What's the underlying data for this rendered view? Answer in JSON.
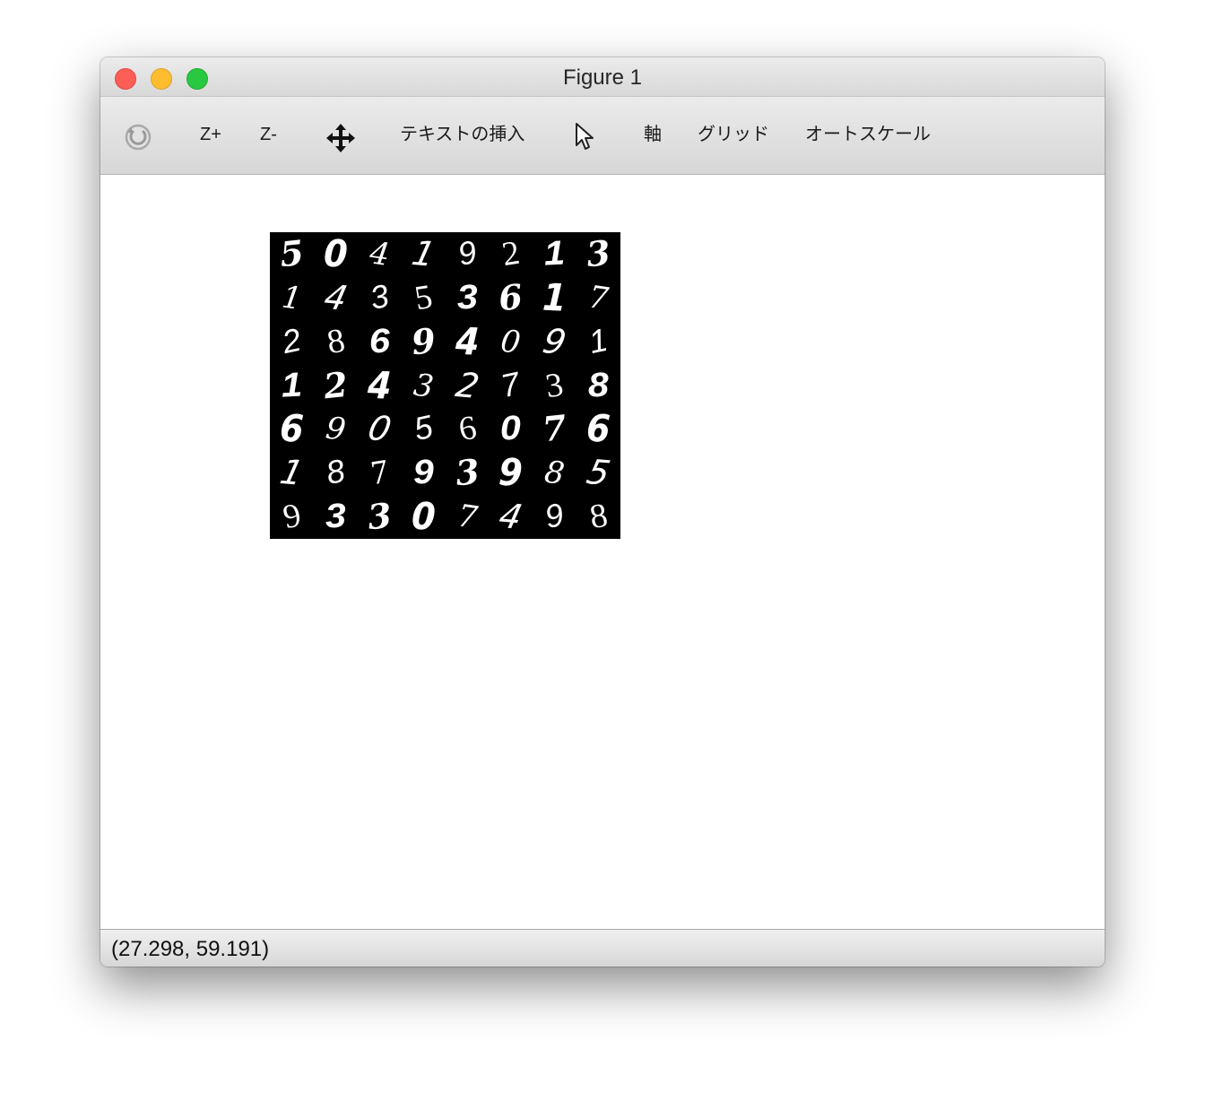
{
  "window": {
    "title": "Figure 1"
  },
  "toolbar": {
    "reset_icon": "refresh-circle-icon",
    "zoom_in_label": "Z+",
    "zoom_out_label": "Z-",
    "pan_icon": "move-arrows-icon",
    "insert_text_label": "テキストの挿入",
    "select_icon": "cursor-arrow-icon",
    "axes_label": "軸",
    "grid_label": "グリッド",
    "autoscale_label": "オートスケール"
  },
  "figure": {
    "digit_grid": [
      [
        "5",
        "0",
        "4",
        "1",
        "9",
        "2",
        "1",
        "3"
      ],
      [
        "1",
        "4",
        "3",
        "5",
        "3",
        "6",
        "1",
        "7"
      ],
      [
        "2",
        "8",
        "6",
        "9",
        "4",
        "0",
        "9",
        "1"
      ],
      [
        "1",
        "2",
        "4",
        "3",
        "2",
        "7",
        "3",
        "8"
      ],
      [
        "6",
        "9",
        "0",
        "5",
        "6",
        "0",
        "7",
        "6"
      ],
      [
        "1",
        "8",
        "7",
        "9",
        "3",
        "9",
        "8",
        "5"
      ],
      [
        "9",
        "3",
        "3",
        "0",
        "7",
        "4",
        "9",
        "8"
      ]
    ]
  },
  "status": {
    "coordinates": "(27.298, 59.191)"
  },
  "colors": {
    "close": "#fd5f57",
    "minimize": "#fdbd2f",
    "maximize": "#28c941",
    "image_background": "#000000",
    "digit_stroke": "#ffffff"
  }
}
